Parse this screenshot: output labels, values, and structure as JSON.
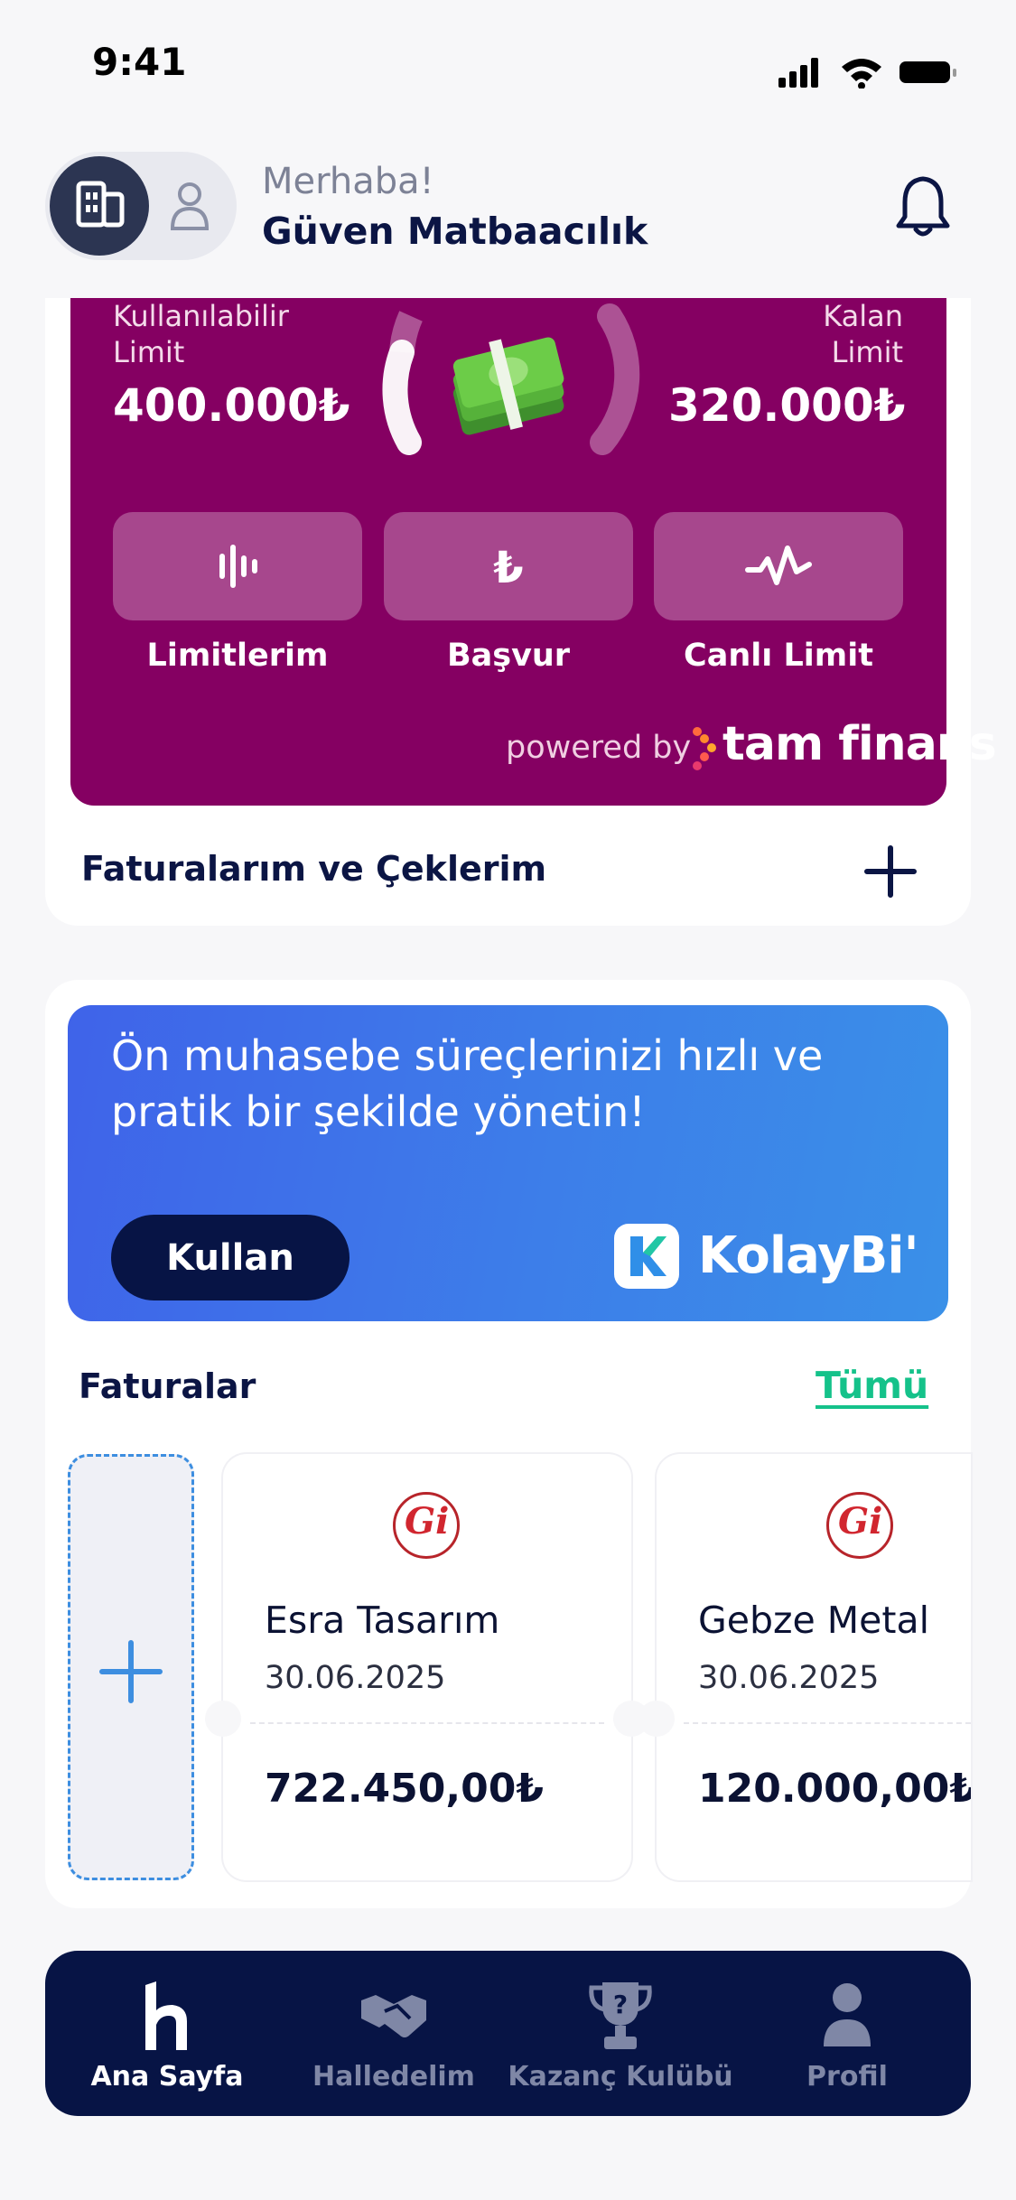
{
  "status_bar": {
    "time": "9:41"
  },
  "header": {
    "greeting": "Merhaba!",
    "company": "Güven Matbaacılık"
  },
  "limit_card": {
    "available_label_line1": "Kullanılabilir",
    "available_label_line2": "Limit",
    "available_value": "400.000₺",
    "remaining_label_line1": "Kalan",
    "remaining_label_line2": "Limit",
    "remaining_value": "320.000₺",
    "actions": [
      {
        "label": "Limitlerim",
        "icon": "bars-icon"
      },
      {
        "label": "Başvur",
        "icon": "lira-icon"
      },
      {
        "label": "Canlı Limit",
        "icon": "pulse-icon"
      }
    ],
    "powered_by": "powered by",
    "brand": "tam finans",
    "colors": {
      "card": "#850062"
    }
  },
  "invoices_checks": {
    "title": "Faturalarım ve Çeklerim"
  },
  "banner": {
    "text": "Ön muhasebe süreçlerinizi hızlı ve pratik bir şekilde yönetin!",
    "button": "Kullan",
    "brand": "KolayBi'"
  },
  "faturalar": {
    "title": "Faturalar",
    "see_all": "Tümü",
    "items": [
      {
        "name": "Esra Tasarım",
        "date": "30.06.2025",
        "amount": "722.450,00₺"
      },
      {
        "name": "Gebze Metal",
        "date": "30.06.2025",
        "amount": "120.000,00₺"
      }
    ]
  },
  "tabbar": {
    "tabs": [
      {
        "label": "Ana Sayfa",
        "icon": "home-icon",
        "active": true
      },
      {
        "label": "Halledelim",
        "icon": "handshake-icon",
        "active": false
      },
      {
        "label": "Kazanç Kulübü",
        "icon": "trophy-icon",
        "active": false
      },
      {
        "label": "Profil",
        "icon": "person-icon",
        "active": false
      }
    ]
  }
}
